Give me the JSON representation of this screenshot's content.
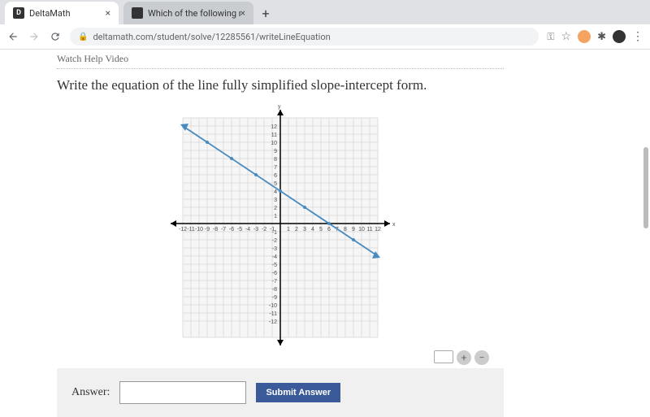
{
  "browser": {
    "tabs": [
      {
        "label": "DeltaMath",
        "favicon": "DM"
      },
      {
        "label": "Which of the following number",
        "favicon": "G"
      }
    ],
    "url": "deltamath.com/student/solve/12285561/writeLineEquation"
  },
  "help_link": "Watch Help Video",
  "question": "Write the equation of the line fully simplified slope-intercept form.",
  "answer_label": "Answer:",
  "answer_value": "",
  "submit_label": "Submit Answer",
  "chart_data": {
    "type": "line",
    "title": "",
    "xlabel": "x",
    "ylabel": "y",
    "xlim": [
      -12,
      12
    ],
    "ylim": [
      -12,
      12
    ],
    "xticks": [
      -12,
      -11,
      -10,
      -9,
      -8,
      -7,
      -6,
      -5,
      -4,
      -3,
      -2,
      -1,
      1,
      2,
      3,
      4,
      5,
      6,
      7,
      8,
      9,
      10,
      11,
      12
    ],
    "yticks": [
      -12,
      -11,
      -10,
      -9,
      -8,
      -7,
      -6,
      -5,
      -4,
      -3,
      -2,
      -1,
      1,
      2,
      3,
      4,
      5,
      6,
      7,
      8,
      9,
      10,
      11,
      12
    ],
    "grid": true,
    "series": [
      {
        "name": "line",
        "color": "#4a8bbf",
        "points": [
          [
            -12,
            12
          ],
          [
            -11,
            11.33
          ],
          [
            -9,
            10
          ],
          [
            -6,
            8
          ],
          [
            -3,
            6
          ],
          [
            0,
            4
          ],
          [
            3,
            2
          ],
          [
            6,
            0
          ],
          [
            9,
            -2
          ],
          [
            12,
            -4
          ]
        ],
        "equation_slope": -0.6667,
        "equation_intercept": 4
      }
    ]
  }
}
